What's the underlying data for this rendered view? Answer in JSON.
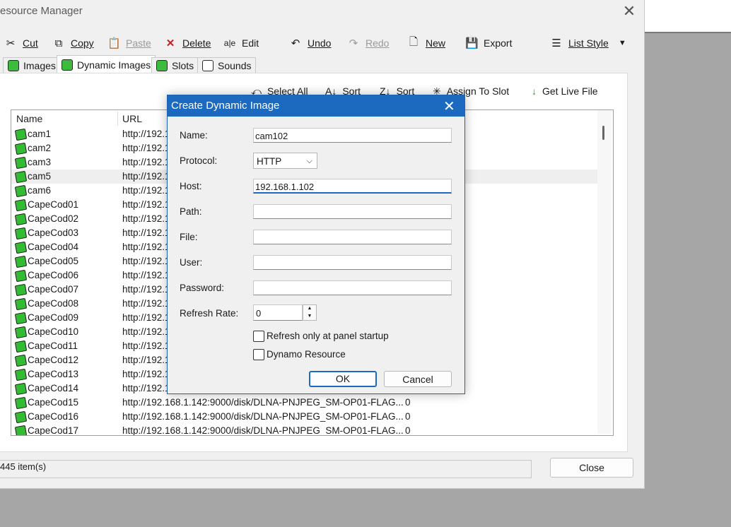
{
  "window": {
    "title": "esource Manager"
  },
  "toolbar": {
    "cut": "Cut",
    "copy": "Copy",
    "paste": "Paste",
    "delete": "Delete",
    "edit": "Edit",
    "undo": "Undo",
    "redo": "Redo",
    "new": "New",
    "export": "Export",
    "list_style": "List Style"
  },
  "tabs": [
    "Images",
    "Dynamic Images",
    "Slots",
    "Sounds"
  ],
  "actions": {
    "select_all": "Select All",
    "sort_asc": "Sort",
    "sort_desc": "Sort",
    "assign_to_slot": "Assign To Slot",
    "get_live_file": "Get Live File"
  },
  "list": {
    "headers": {
      "name": "Name",
      "url": "URL"
    },
    "rows": [
      {
        "name": "cam1",
        "url": "http://192.1"
      },
      {
        "name": "cam2",
        "url": "http://192.1"
      },
      {
        "name": "cam3",
        "url": "http://192.1"
      },
      {
        "name": "cam5",
        "url": "http://192.1"
      },
      {
        "name": "cam6",
        "url": "http://192.1"
      },
      {
        "name": "CapeCod01",
        "url": "http://192.1"
      },
      {
        "name": "CapeCod02",
        "url": "http://192.1"
      },
      {
        "name": "CapeCod03",
        "url": "http://192.1"
      },
      {
        "name": "CapeCod04",
        "url": "http://192.1"
      },
      {
        "name": "CapeCod05",
        "url": "http://192.1"
      },
      {
        "name": "CapeCod06",
        "url": "http://192.1"
      },
      {
        "name": "CapeCod07",
        "url": "http://192.1"
      },
      {
        "name": "CapeCod08",
        "url": "http://192.1"
      },
      {
        "name": "CapeCod09",
        "url": "http://192.1"
      },
      {
        "name": "CapeCod10",
        "url": "http://192.1"
      },
      {
        "name": "CapeCod11",
        "url": "http://192.1"
      },
      {
        "name": "CapeCod12",
        "url": "http://192.1"
      },
      {
        "name": "CapeCod13",
        "url": "http://192.1"
      },
      {
        "name": "CapeCod14",
        "url": "http://192.1"
      },
      {
        "name": "CapeCod15",
        "url": "http://192.168.1.142:9000/disk/DLNA-PNJPEG_SM-OP01-FLAG...",
        "value": "0"
      },
      {
        "name": "CapeCod16",
        "url": "http://192.168.1.142:9000/disk/DLNA-PNJPEG_SM-OP01-FLAG...",
        "value": "0"
      },
      {
        "name": "CapeCod17",
        "url": "http://192.168.1.142:9000/disk/DLNA-PNJPEG_SM-OP01-FLAG...",
        "value": "0"
      }
    ],
    "selected_row": "cam5"
  },
  "status": {
    "count": "445 item(s)",
    "close": "Close"
  },
  "dialog": {
    "title": "Create Dynamic Image",
    "labels": {
      "name": "Name:",
      "protocol": "Protocol:",
      "host": "Host:",
      "path": "Path:",
      "file": "File:",
      "user": "User:",
      "password": "Password:",
      "refresh_rate": "Refresh Rate:"
    },
    "values": {
      "name": "cam102",
      "protocol": "HTTP",
      "host": "192.168.1.102",
      "path": "",
      "file": "",
      "user": "",
      "password": "",
      "refresh_rate": "0"
    },
    "checkboxes": {
      "refresh_startup": "Refresh only at panel startup",
      "dynamo": "Dynamo Resource"
    },
    "ok": "OK",
    "cancel": "Cancel"
  }
}
